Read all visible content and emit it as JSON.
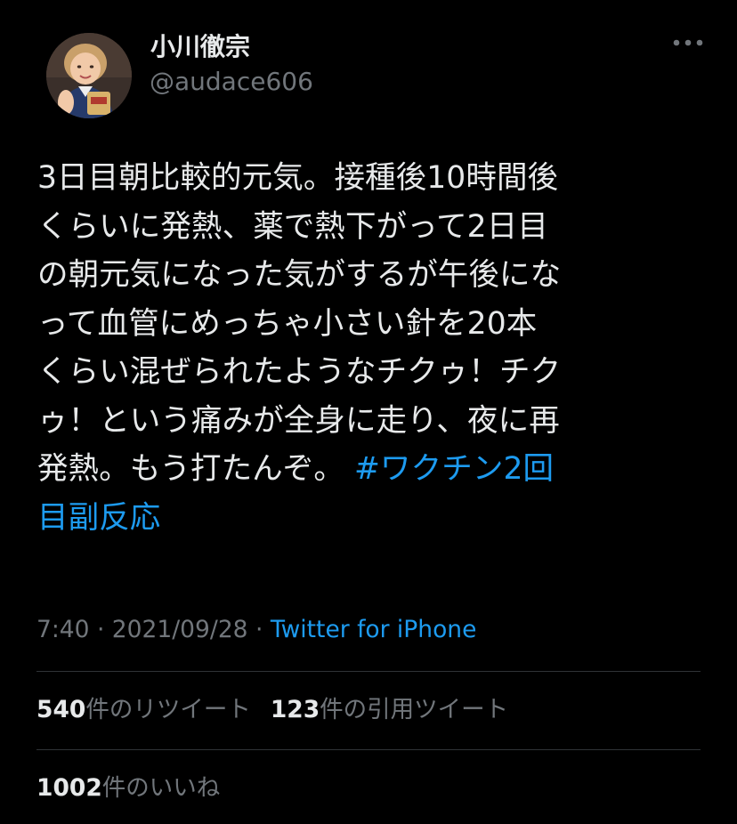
{
  "user": {
    "display_name": "小川徹宗",
    "handle": "@audace606"
  },
  "tweet": {
    "lines": [
      "3日目朝比較的元気。接種後10時間後",
      "くらいに発熱、薬で熱下がって2日目",
      "の朝元気になった気がするが午後にな",
      "って血管にめっちゃ小さい針を20本",
      "くらい混ぜられたようなチクゥ！チク",
      "ゥ！という痛みが全身に走り、夜に再"
    ],
    "line7_text": "発熱。もう打たんぞ。",
    "hashtag_part1": "#ワクチン2回",
    "hashtag_part2": "目副反応"
  },
  "meta": {
    "time": "7:40",
    "separator": " · ",
    "date": "2021/09/28",
    "separator2": " · ",
    "source": "Twitter for iPhone"
  },
  "stats": {
    "retweets_count": "540",
    "retweets_label": "件のリツイート",
    "quotes_count": "123",
    "quotes_label": "件の引用ツイート",
    "likes_count": "1002",
    "likes_label": "件のいいね"
  },
  "icons": {
    "more": "more-horizontal-icon"
  },
  "colors": {
    "background": "#000000",
    "text": "#e7e9ea",
    "secondary": "#71767b",
    "accent": "#1d9bf0",
    "divider": "#2f3336"
  }
}
